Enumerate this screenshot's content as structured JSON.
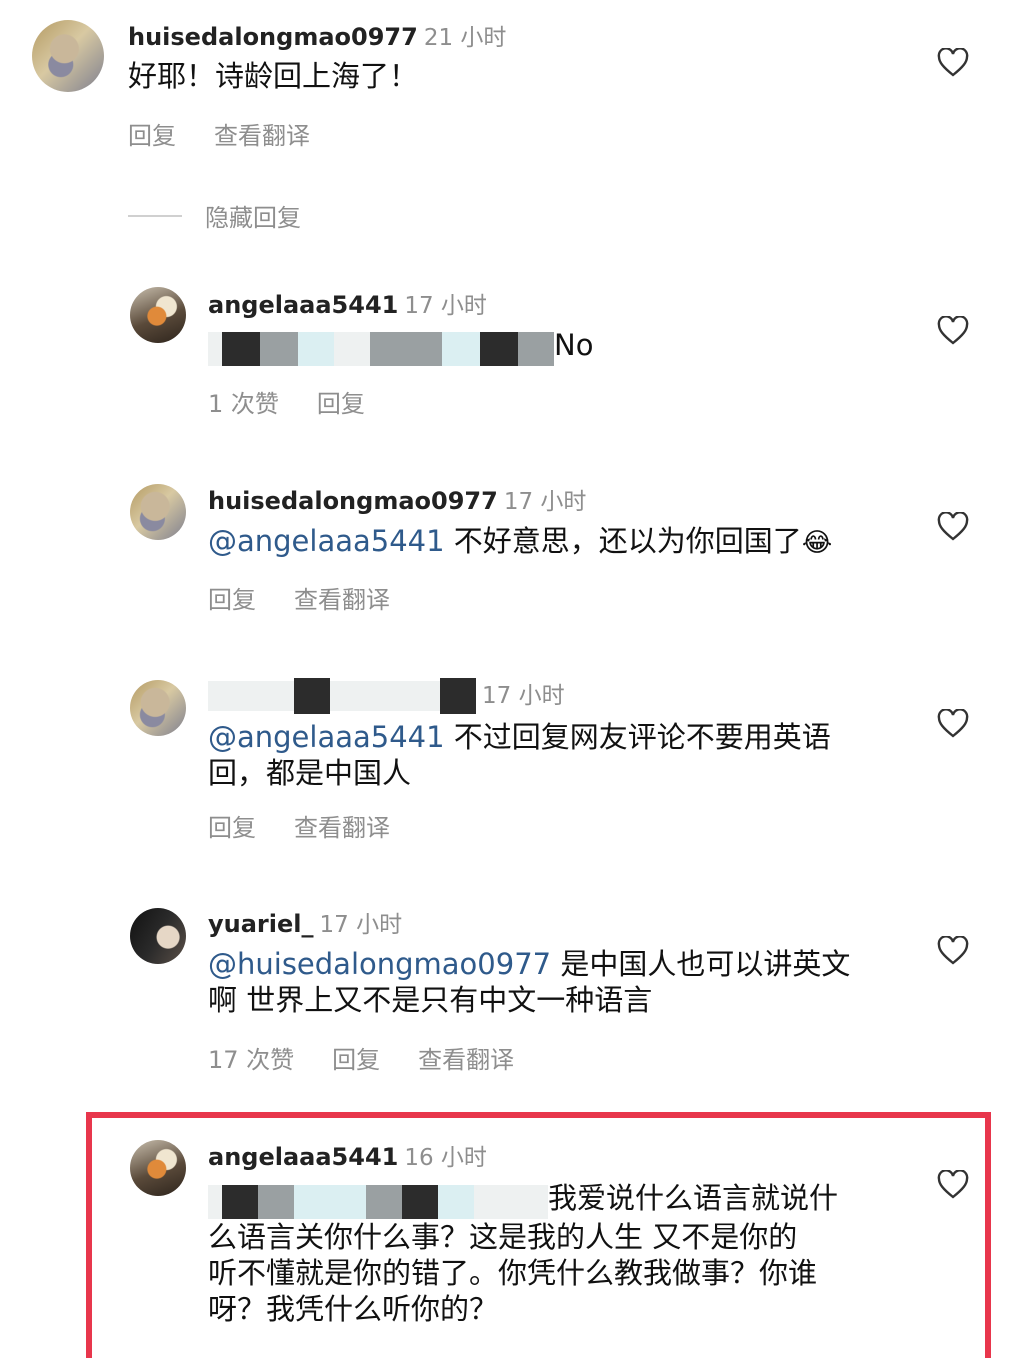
{
  "hide_replies_label": "隐藏回复",
  "comments": [
    {
      "username": "huisedalongmao0977",
      "time": "21 小时",
      "text": "好耶！诗龄回上海了！",
      "actions": [
        "回复",
        "查看翻译"
      ]
    },
    {
      "username": "angelaaa5441",
      "time": "17 小时",
      "text_suffix": "No",
      "actions": [
        "1 次赞",
        "回复"
      ]
    },
    {
      "username": "huisedalongmao0977",
      "time": "17 小时",
      "mention": "@angelaaa5441",
      "text": "不好意思，还以为你回国了",
      "emoji": "😂",
      "actions": [
        "回复",
        "查看翻译"
      ]
    },
    {
      "time": "17 小时",
      "mention": "@angelaaa5441",
      "text_line1": "不过回复网友评论不要用英语",
      "text_line2": "回，都是中国人",
      "actions": [
        "回复",
        "查看翻译"
      ]
    },
    {
      "username": "yuariel_",
      "time": "17 小时",
      "mention": "@huisedalongmao0977",
      "text_line1": "是中国人也可以讲英文",
      "text_line2": "啊 世界上又不是只有中文一种语言",
      "actions": [
        "17 次赞",
        "回复",
        "查看翻译"
      ]
    },
    {
      "username": "angelaaa5441",
      "time": "16 小时",
      "text_line1": "我爱说什么语言就说什",
      "text_line2": "么语言关你什么事？这是我的人生 又不是你的",
      "text_line3": "听不懂就是你的错了。你凭什么教我做事？你谁",
      "text_line4": "呀？我凭什么听你的？"
    }
  ],
  "colors": {
    "mention": "#2f5a8b",
    "highlight_border": "#e8364c",
    "muted": "#8e8e8e"
  },
  "icons": [
    "heart-icon"
  ]
}
